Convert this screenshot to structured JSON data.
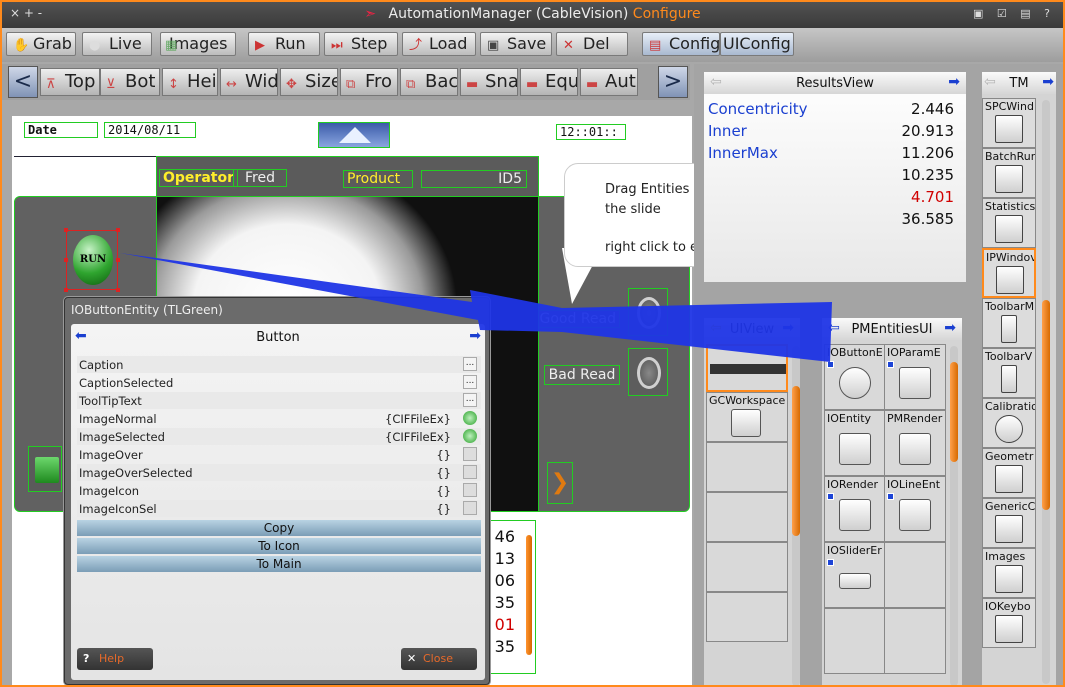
{
  "window": {
    "title_app": "AutomationManager",
    "title_ctx": "(CableVision)",
    "title_mode": "Configure",
    "left_controls": "×   +   -",
    "right_controls": "▣ ☑ ▤ ?"
  },
  "toolbar": [
    {
      "label": "Grab",
      "icon": "grab-icon"
    },
    {
      "label": "Live",
      "icon": "live-icon"
    },
    {
      "label": "Images",
      "icon": "images-icon"
    },
    {
      "label": "Run",
      "icon": "run-icon"
    },
    {
      "label": "Step",
      "icon": "step-icon"
    },
    {
      "label": "Load",
      "icon": "load-icon"
    },
    {
      "label": "Save",
      "icon": "save-icon"
    },
    {
      "label": "Del",
      "icon": "delete-icon"
    },
    {
      "label": "Config",
      "icon": "config-icon"
    },
    {
      "label": "UIConfig",
      "icon": ""
    }
  ],
  "toolbar2": [
    "Top",
    "Bot",
    "Hei",
    "Wid",
    "Size",
    "Fro",
    "Bac",
    "Sna",
    "Equ",
    "Aut"
  ],
  "slide": {
    "date_label": "Date",
    "date_value": "2014/08/11",
    "time_value": "12::01::",
    "operator_label": "Operator",
    "operator_value": "Fred",
    "product_label": "Product",
    "product_value": "ID5",
    "run_button": "RUN",
    "good_read": "Good Read",
    "bad_read": "Bad Read",
    "numbers": [
      "46",
      "13",
      "06",
      "35",
      "01",
      "35"
    ],
    "highlight_color": "#d00000"
  },
  "bubble": {
    "line1": "Drag Entities on to",
    "line2": "the slide",
    "line3": "right click to edit"
  },
  "dialog": {
    "title": "IOButtonEntity (TLGreen)",
    "header": "Button",
    "properties": [
      {
        "name": "Caption",
        "value": "",
        "btn": "..."
      },
      {
        "name": "CaptionSelected",
        "value": "",
        "btn": "..."
      },
      {
        "name": "ToolTipText",
        "value": "",
        "btn": "..."
      },
      {
        "name": "ImageNormal",
        "value": "{CIFFileEx}",
        "btn": "gem"
      },
      {
        "name": "ImageSelected",
        "value": "{CIFFileEx}",
        "btn": "gem"
      },
      {
        "name": "ImageOver",
        "value": "{}",
        "btn": "blank"
      },
      {
        "name": "ImageOverSelected",
        "value": "{}",
        "btn": "blank"
      },
      {
        "name": "ImageIcon",
        "value": "{}",
        "btn": "blank"
      },
      {
        "name": "ImageIconSel",
        "value": "{}",
        "btn": "blank"
      }
    ],
    "actions": [
      "Copy",
      "To Icon",
      "To Main"
    ],
    "help": "Help",
    "close": "Close"
  },
  "results": {
    "title": "ResultsView",
    "rows": [
      {
        "key": "Concentricity",
        "value": "2.446",
        "color": "#111111"
      },
      {
        "key": "Inner",
        "value": "20.913",
        "color": "#111111"
      },
      {
        "key": "InnerMax",
        "value": "11.206",
        "color": "#111111"
      },
      {
        "key": "",
        "value": "10.235",
        "color": "#111111"
      },
      {
        "key": "",
        "value": "4.701",
        "color": "#d00000"
      },
      {
        "key": "",
        "value": "36.585",
        "color": "#111111"
      }
    ]
  },
  "uiview": {
    "title": "UIView",
    "items": [
      "",
      "GCWorkspace"
    ]
  },
  "pmentities": {
    "title": "PMEntitiesUI",
    "items": [
      "IOButtonE",
      "IOParamE",
      "IOEntity",
      "PMRender",
      "IORender",
      "IOLineEnt",
      "IOSliderEr"
    ]
  },
  "tm": {
    "title": "TM",
    "items": [
      "SPCWind",
      "BatchRun",
      "Statistics",
      "IPWindov",
      "ToolbarM",
      "ToolbarV",
      "Calibratio",
      "Geometr",
      "GenericC",
      "Images",
      "IOKeybo"
    ]
  },
  "colors": {
    "accent": "#ff8a1c",
    "link_blue": "#1a3fd0",
    "field_green": "#22cc22"
  }
}
